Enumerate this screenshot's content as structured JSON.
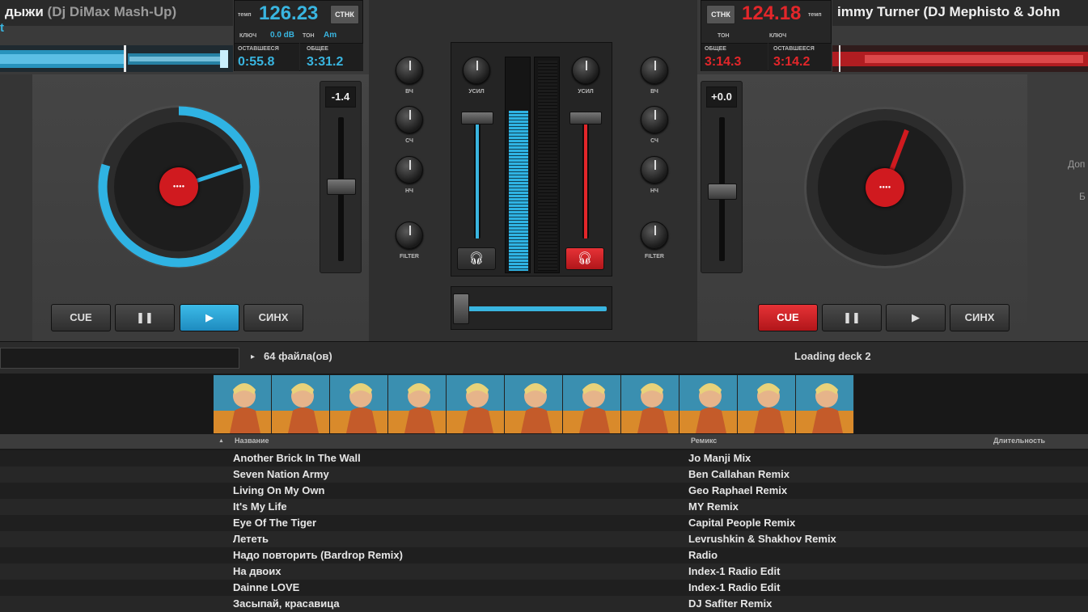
{
  "colors": {
    "accent_blue": "#39b5e0",
    "accent_red": "#e3262a",
    "panel": "#3a3a3a"
  },
  "deck_left": {
    "title_main": "дыжи",
    "title_muted": "(Dj DiMax Mash-Up)",
    "subtitle": "t",
    "bpm_label": "темп",
    "bpm": "126.23",
    "sync_label": "СТНК",
    "key_label": "КЛЮЧ",
    "key_value": "0.0 dB",
    "gain_label": "ТОН",
    "gain_value": "Am",
    "remaining_label": "ОСТАВШЕЕСЯ",
    "remaining": "0:55.8",
    "total_label": "ОБЩЕЕ",
    "total": "3:31.2",
    "pitch": "-1.4",
    "buttons": {
      "cue": "CUE",
      "pause": "❚❚",
      "play": "▶",
      "sync": "СИНХ"
    }
  },
  "deck_right": {
    "title": "immy Turner (DJ Mephisto & John",
    "bpm_label": "темп",
    "bpm": "124.18",
    "sync_label": "СТНК",
    "key_label": "ТОН",
    "gain_label": "КЛЮЧ",
    "total_label": "ОБЩЕЕ",
    "total": "3:14.3",
    "remaining_label": "ОСТАВШЕЕСЯ",
    "remaining": "3:14.2",
    "pitch": "+0.0",
    "side_text_1": "Доп",
    "side_text_2": "Б",
    "buttons": {
      "cue": "CUE",
      "pause": "❚❚",
      "play": "▶",
      "sync": "СИНХ"
    }
  },
  "mixer": {
    "left_knobs": [
      "ВЧ",
      "СЧ",
      "НЧ",
      "FILTER"
    ],
    "right_knobs": [
      "ВЧ",
      "СЧ",
      "НЧ",
      "FILTER"
    ],
    "gain_left": "УСИЛ",
    "gain_right": "УСИЛ",
    "headphone_icon": "headphones-icon"
  },
  "browser": {
    "file_count": "64 файла(ов)",
    "status": "Loading deck 2",
    "columns": {
      "title": "Название",
      "remix": "Ремикс",
      "duration": "Длительность"
    },
    "tracks": [
      {
        "title": "Another Brick In The Wall",
        "remix": "Jo Manji Mix"
      },
      {
        "title": "Seven Nation Army",
        "remix": "Ben Callahan Remix"
      },
      {
        "title": "Living On My Own",
        "remix": "Geo Raphael Remix"
      },
      {
        "title": "It's My Life",
        "remix": "MY Remix"
      },
      {
        "title": "Eye Of The Tiger",
        "remix": "Capital People Remix"
      },
      {
        "title": "Лететь",
        "remix": "Levrushkin & Shakhov Remix"
      },
      {
        "title": "Надо повторить (Bardrop Remix)",
        "remix": "Radio"
      },
      {
        "title": "На двоих",
        "remix": "Index-1 Radio Edit"
      },
      {
        "title": "Dainne LOVE",
        "remix": "Index-1 Radio Edit"
      },
      {
        "title": "Засыпай, красавица",
        "remix": "DJ Safiter Remix"
      }
    ]
  }
}
